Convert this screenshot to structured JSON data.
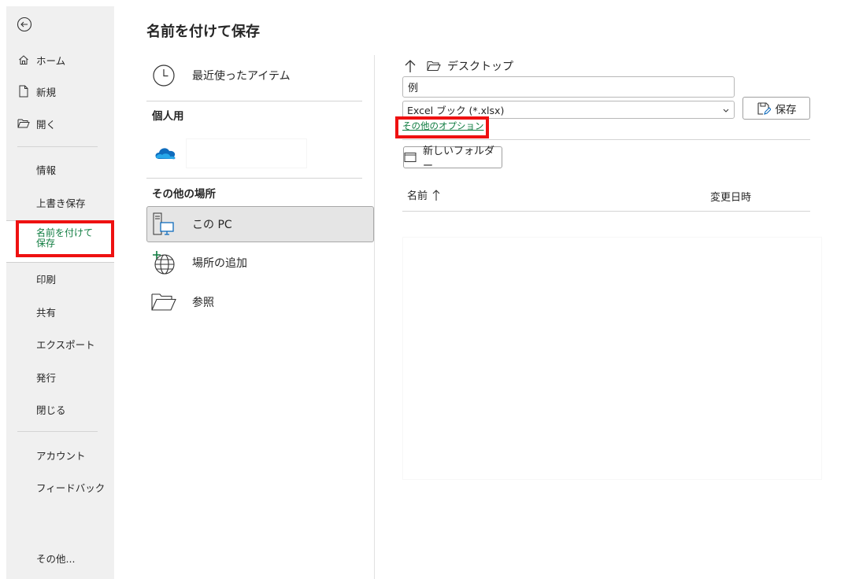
{
  "nav": {
    "back_icon": "back-arrow-icon",
    "items": [
      {
        "label": "ホーム",
        "icon": "home-icon"
      },
      {
        "label": "新規",
        "icon": "new-doc-icon"
      },
      {
        "label": "開く",
        "icon": "open-folder-icon"
      }
    ],
    "info": "情報",
    "save": "上書き保存",
    "save_as": "名前を付けて保存",
    "print": "印刷",
    "share": "共有",
    "export": "エクスポート",
    "publish": "発行",
    "close": "閉じる",
    "account": "アカウント",
    "feedback": "フィードバック",
    "more": "その他..."
  },
  "main": {
    "title": "名前を付けて保存",
    "recent": "最近使ったアイテム",
    "personal_section": "個人用",
    "other_section": "その他の場所",
    "this_pc": "この PC",
    "add_place": "場所の追加",
    "browse": "参照"
  },
  "panel": {
    "path": "デスクトップ",
    "filename_value": "例",
    "filetype": "Excel ブック (*.xlsx)",
    "save_label": "保存",
    "more_options": "その他のオプション",
    "new_folder": "新しいフォルダー",
    "col_name": "名前",
    "col_date": "変更日時"
  },
  "colors": {
    "accent": "#107c41",
    "highlight": "#ee1111",
    "nav_bg": "#f0f0f0"
  }
}
